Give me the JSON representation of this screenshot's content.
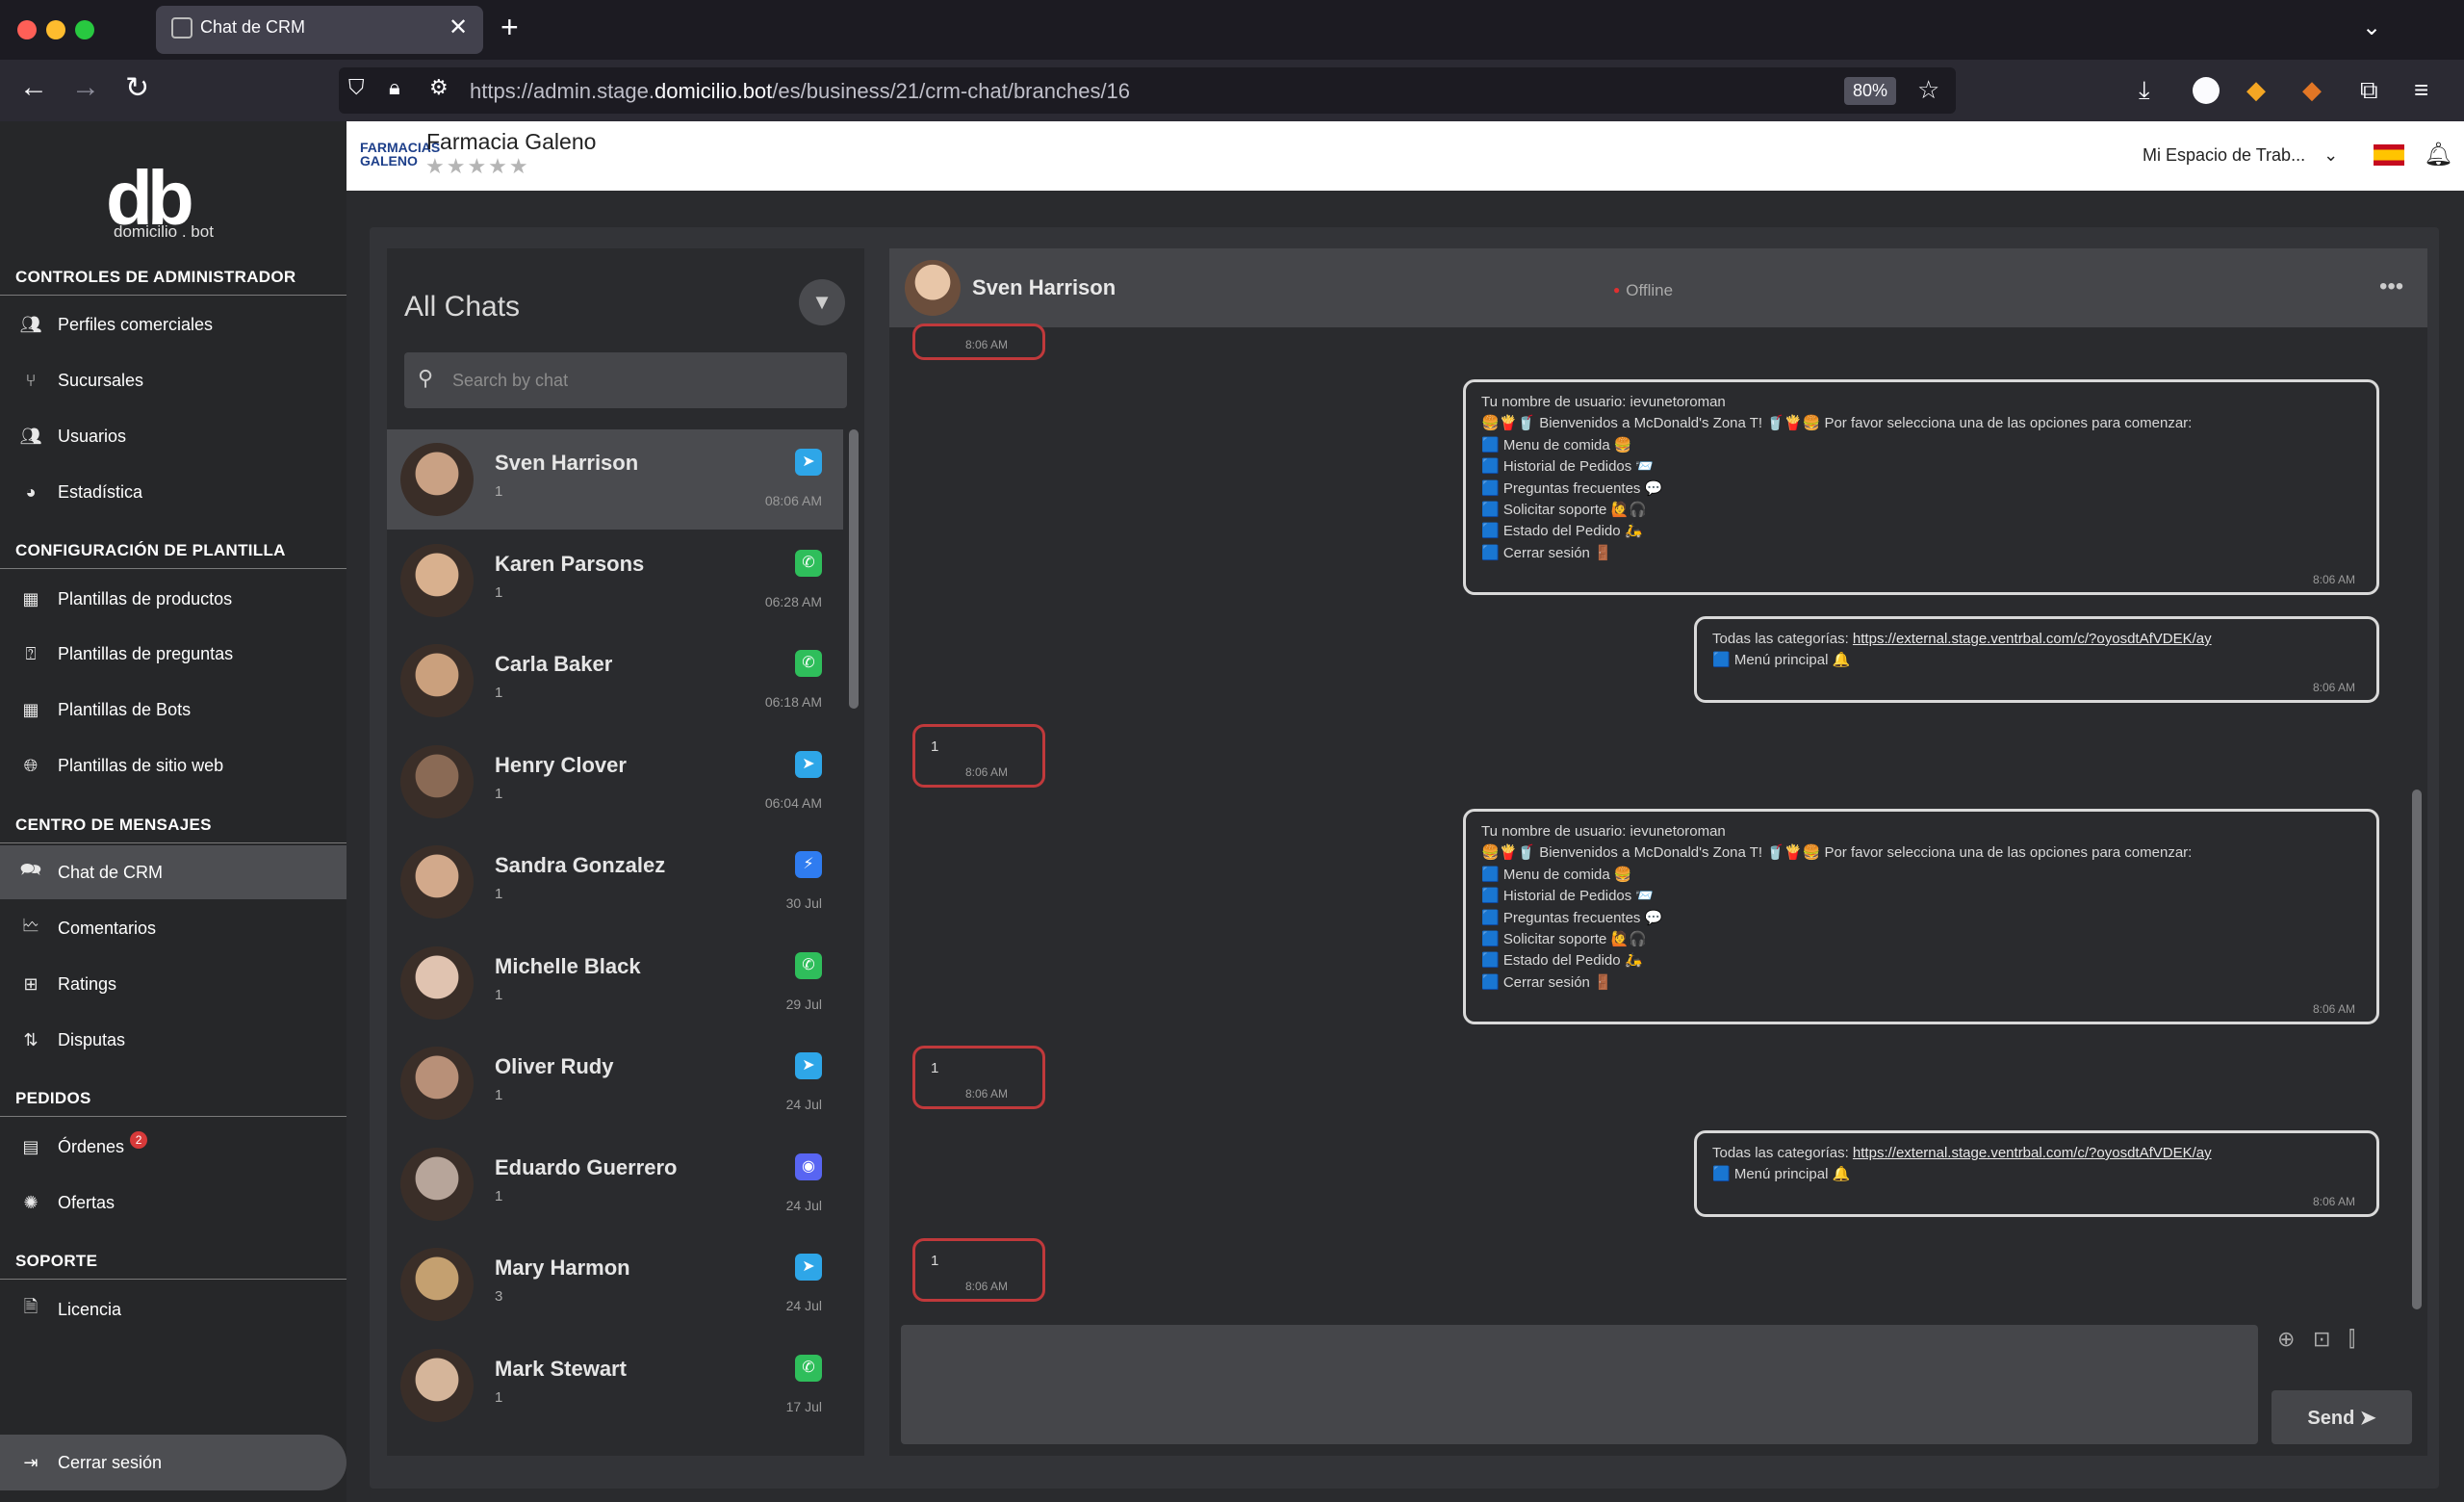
{
  "browser": {
    "tab_title": "Chat de CRM",
    "tab_close": "✕",
    "new_tab": "+",
    "tab_list": "⌄",
    "url_prefix": "https://admin.stage.",
    "url_domain": "domicilio.bot",
    "url_path": "/es/business/21/crm-chat/branches/16",
    "zoom": "80%"
  },
  "sidebar": {
    "logo_mark": "db",
    "logo_text": "domicilio . bot",
    "sections": [
      {
        "title": "CONTROLES DE ADMINISTRADOR"
      },
      {
        "title": "CONFIGURACIÓN DE PLANTILLA"
      },
      {
        "title": "CENTRO DE MENSAJES"
      },
      {
        "title": "PEDIDOS"
      },
      {
        "title": "SOPORTE"
      }
    ],
    "items": [
      {
        "label": "Perfiles comerciales",
        "icon": "users-icon"
      },
      {
        "label": "Sucursales",
        "icon": "branch-icon"
      },
      {
        "label": "Usuarios",
        "icon": "users-icon"
      },
      {
        "label": "Estadística",
        "icon": "pie-chart-icon"
      },
      {
        "label": "Plantillas de productos",
        "icon": "grid-icon"
      },
      {
        "label": "Plantillas de preguntas",
        "icon": "question-icon"
      },
      {
        "label": "Plantillas de Bots",
        "icon": "grid-icon"
      },
      {
        "label": "Plantillas de sitio web",
        "icon": "globe-icon"
      },
      {
        "label": "Chat de CRM",
        "icon": "chat-icon"
      },
      {
        "label": "Comentarios",
        "icon": "comment-icon"
      },
      {
        "label": "Ratings",
        "icon": "rating-icon"
      },
      {
        "label": "Disputas",
        "icon": "dispute-icon"
      },
      {
        "label": "Órdenes",
        "icon": "orders-icon",
        "badge": "2"
      },
      {
        "label": "Ofertas",
        "icon": "offers-icon"
      },
      {
        "label": "Licencia",
        "icon": "license-icon"
      }
    ],
    "logout": "Cerrar sesión"
  },
  "header": {
    "business_logo_text": "FARMACIAS GALENO",
    "business_name": "Farmacia Galeno",
    "rating_stars": "★★★★★",
    "workspace": "Mi Espacio de Trab...",
    "workspace_chevron": "⌄"
  },
  "chatlist": {
    "title": "All Chats",
    "search_placeholder": "Search by chat",
    "chats": [
      {
        "name": "Sven Harrison",
        "msg": "1",
        "time": "08:06 AM",
        "channel": "telegram-icon",
        "color": "#2ea6e8"
      },
      {
        "name": "Karen Parsons",
        "msg": "1",
        "time": "06:28 AM",
        "channel": "whatsapp-icon",
        "color": "#2fbe5b"
      },
      {
        "name": "Carla Baker",
        "msg": "1",
        "time": "06:18 AM",
        "channel": "whatsapp-icon",
        "color": "#2fbe5b"
      },
      {
        "name": "Henry Clover",
        "msg": "1",
        "time": "06:04 AM",
        "channel": "telegram-icon",
        "color": "#2ea6e8"
      },
      {
        "name": "Sandra Gonzalez",
        "msg": "1",
        "time": "30 Jul",
        "channel": "messenger-icon",
        "color": "#2f7cf0"
      },
      {
        "name": "Michelle Black",
        "msg": "1",
        "time": "29 Jul",
        "channel": "whatsapp-icon",
        "color": "#2fbe5b"
      },
      {
        "name": "Oliver Rudy",
        "msg": "1",
        "time": "24 Jul",
        "channel": "telegram-icon",
        "color": "#2ea6e8"
      },
      {
        "name": "Eduardo Guerrero",
        "msg": "1",
        "time": "24 Jul",
        "channel": "discord-icon",
        "color": "#5865f2"
      },
      {
        "name": "Mary Harmon",
        "msg": "3",
        "time": "24 Jul",
        "channel": "telegram-icon",
        "color": "#2ea6e8"
      },
      {
        "name": "Mark Stewart",
        "msg": "1",
        "time": "17 Jul",
        "channel": "whatsapp-icon",
        "color": "#2fbe5b"
      }
    ]
  },
  "chat": {
    "contact_name": "Sven Harrison",
    "status": "Offline",
    "more": "•••",
    "messages": [
      {
        "dir": "in",
        "text": "",
        "time": "8:06 AM"
      },
      {
        "dir": "out",
        "text": "Tu nombre de usuario: ievunetoroman\n🍔🍟🥤 Bienvenidos a McDonald's Zona T! 🥤🍟🍔 Por favor selecciona una de las opciones para comenzar:\n🟦 Menu de comida 🍔\n🟦 Historial de Pedidos 📨\n🟦 Preguntas frecuentes 💬\n🟦 Solicitar soporte 🙋🎧\n🟦 Estado del Pedido 🛵\n🟦 Cerrar sesión 🚪",
        "time": "8:06 AM"
      },
      {
        "dir": "out",
        "text": "Todas las categorías: \n🟦 Menú principal 🔔",
        "link": "https://external.stage.ventrbal.com/c/?oyosdtAfVDEK/ay",
        "time": "8:06 AM"
      },
      {
        "dir": "in",
        "text": "1",
        "time": "8:06 AM"
      },
      {
        "dir": "out",
        "text": "Tu nombre de usuario: ievunetoroman\n🍔🍟🥤 Bienvenidos a McDonald's Zona T! 🥤🍟🍔 Por favor selecciona una de las opciones para comenzar:\n🟦 Menu de comida 🍔\n🟦 Historial de Pedidos 📨\n🟦 Preguntas frecuentes 💬\n🟦 Solicitar soporte 🙋🎧\n🟦 Estado del Pedido 🛵\n🟦 Cerrar sesión 🚪",
        "time": "8:06 AM"
      },
      {
        "dir": "in",
        "text": "1",
        "time": "8:06 AM"
      },
      {
        "dir": "out",
        "text": "Todas las categorías: \n🟦 Menú principal 🔔",
        "link": "https://external.stage.ventrbal.com/c/?oyosdtAfVDEK/ay",
        "time": "8:06 AM"
      },
      {
        "dir": "in",
        "text": "1",
        "time": "8:06 AM"
      }
    ],
    "composer_placeholder": "",
    "send_label": "Send ➤"
  }
}
